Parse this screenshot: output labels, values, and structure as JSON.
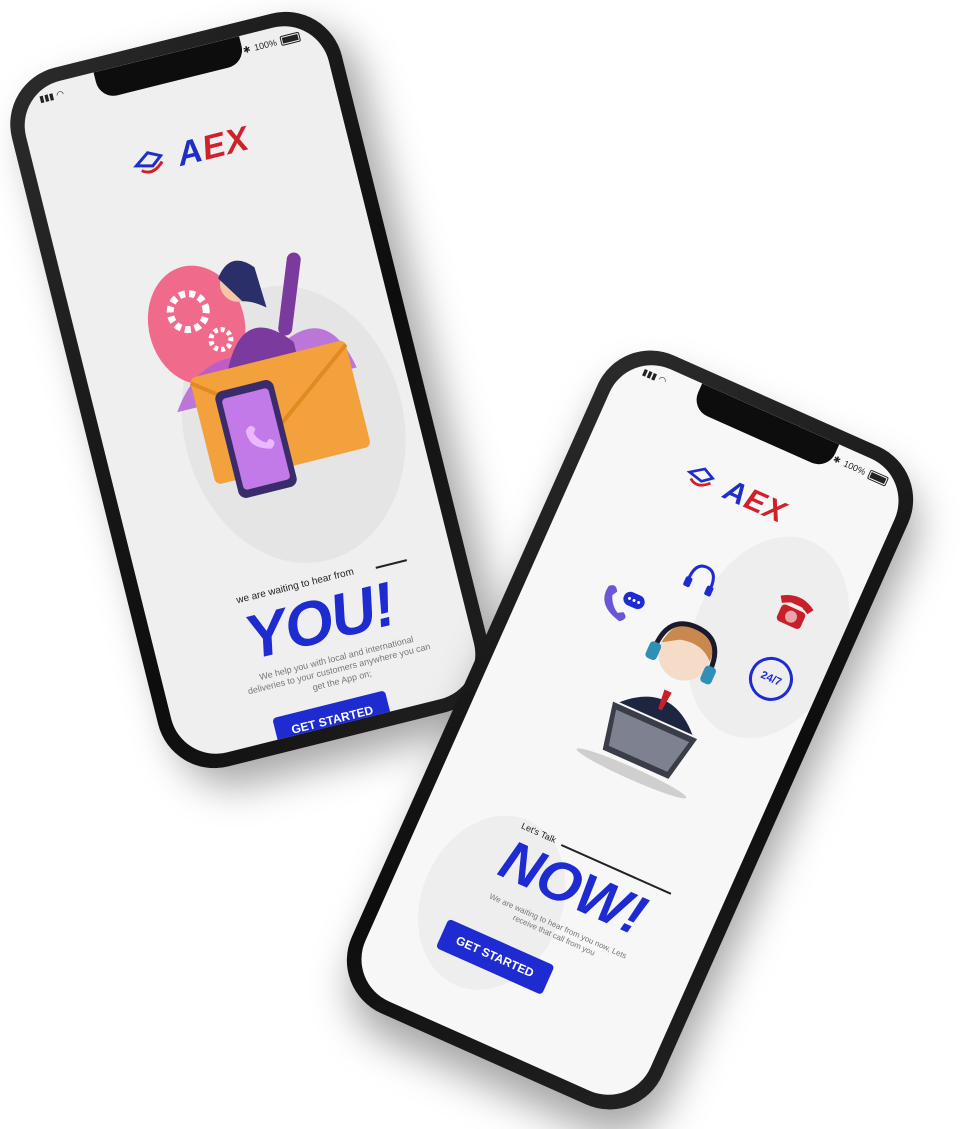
{
  "brand": {
    "name_a": "A",
    "name_rest": "EX"
  },
  "status": {
    "battery": "100%"
  },
  "phone1": {
    "tagline": "we are waiting to hear from",
    "headline": "YOU!",
    "description": "We help you with local and international deliveries to your customers anywhere you can get the App on;",
    "cta": "GET STARTED"
  },
  "phone2": {
    "tagline": "Let's Talk",
    "headline": "NOW!",
    "description": "We are waiting to hear from you now, Lets receive that call from you",
    "cta": "GET STARTED",
    "badge_247": "24/7"
  },
  "colors": {
    "brand_blue": "#1d2bd1",
    "brand_red": "#d0202a"
  }
}
